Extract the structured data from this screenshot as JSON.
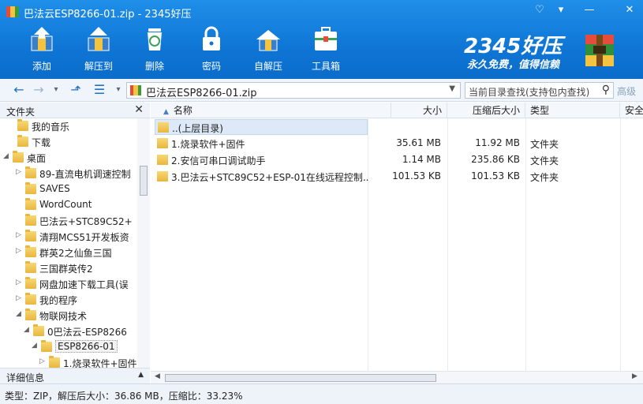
{
  "window": {
    "title": "巴法云ESP8266-01.zip - 2345好压",
    "controls": [
      "skin-icon",
      "minimize-icon",
      "close-icon"
    ]
  },
  "toolbar": {
    "items": [
      {
        "label": "添加",
        "icon": "add-icon"
      },
      {
        "label": "解压到",
        "icon": "extract-icon"
      },
      {
        "label": "删除",
        "icon": "trash-icon"
      },
      {
        "label": "密码",
        "icon": "lock-icon"
      },
      {
        "label": "自解压",
        "icon": "self-extract-icon"
      },
      {
        "label": "工具箱",
        "icon": "toolbox-icon"
      }
    ]
  },
  "brand": {
    "name": "2345好压",
    "slogan": "永久免费，值得信赖"
  },
  "nav": {
    "address": "巴法云ESP8266-01.zip",
    "search_placeholder": "当前目录查找(支持包内查找)",
    "advanced_label": "高级"
  },
  "tree": {
    "header": "文件夹",
    "detail_header": "详细信息",
    "nodes": [
      {
        "label": "我的音乐",
        "expander": "",
        "selected": false
      },
      {
        "label": "下载",
        "expander": "",
        "selected": false
      },
      {
        "label": "桌面",
        "expander": "◢",
        "selected": false
      },
      {
        "label": "89-直流电机调速控制",
        "expander": "▷",
        "selected": false
      },
      {
        "label": "SAVES",
        "expander": "",
        "selected": false
      },
      {
        "label": "WordCount",
        "expander": "",
        "selected": false
      },
      {
        "label": "巴法云+STC89C52+",
        "expander": "",
        "selected": false
      },
      {
        "label": "清翔MCS51开发板资",
        "expander": "▷",
        "selected": false
      },
      {
        "label": "群英2之仙鱼三国",
        "expander": "▷",
        "selected": false
      },
      {
        "label": "三国群英传2",
        "expander": "",
        "selected": false
      },
      {
        "label": "网盘加速下载工具(误",
        "expander": "▷",
        "selected": false
      },
      {
        "label": "我的程序",
        "expander": "▷",
        "selected": false
      },
      {
        "label": "物联网技术",
        "expander": "◢",
        "selected": false
      },
      {
        "label": "0巴法云-ESP8266",
        "expander": "◢",
        "selected": false
      },
      {
        "label": "ESP8266-01",
        "expander": "◢",
        "selected": true
      },
      {
        "label": "1.烧录软件+固件",
        "expander": "▷",
        "selected": false
      }
    ]
  },
  "list": {
    "columns": [
      "名称",
      "大小",
      "压缩后大小",
      "类型",
      "安全"
    ],
    "parent_label": "..(上层目录)",
    "rows": [
      {
        "name": "1.烧录软件+固件",
        "size": "35.61 MB",
        "packed": "11.92 MB",
        "type": "文件夹"
      },
      {
        "name": "2.安信可串口调试助手",
        "size": "1.14 MB",
        "packed": "235.86 KB",
        "type": "文件夹"
      },
      {
        "name": "3.巴法云+STC89C52+ESP-01在线远程控制...",
        "size": "101.53 KB",
        "packed": "101.53 KB",
        "type": "文件夹"
      }
    ]
  },
  "status": {
    "text": "类型：ZIP，解压后大小：36.86 MB，压缩比：33.23%"
  }
}
